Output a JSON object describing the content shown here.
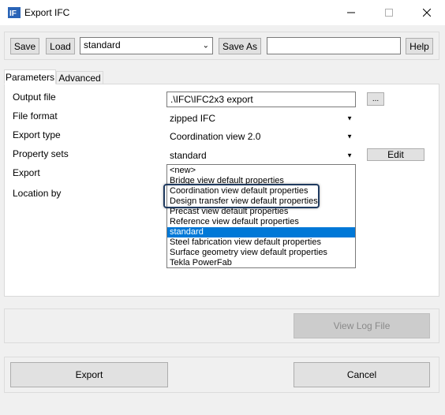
{
  "window": {
    "title": "Export IFC"
  },
  "toolbar": {
    "save_label": "Save",
    "load_label": "Load",
    "preset_value": "standard",
    "save_as_label": "Save As",
    "save_as_value": "",
    "help_label": "Help"
  },
  "tabs": [
    {
      "label": "Parameters"
    },
    {
      "label": "Advanced"
    }
  ],
  "parameters": {
    "output_file": {
      "label": "Output file",
      "value": ".\\IFC\\IFC2x3 export",
      "browse_label": "..."
    },
    "file_format": {
      "label": "File format",
      "value": "zipped IFC"
    },
    "export_type": {
      "label": "Export type",
      "value": "Coordination view 2.0"
    },
    "property_sets": {
      "label": "Property sets",
      "value": "standard",
      "edit_label": "Edit"
    },
    "export": {
      "label": "Export"
    },
    "location_by": {
      "label": "Location by"
    }
  },
  "property_sets_options": [
    "<new>",
    "Bridge view default properties",
    "Coordination view default properties",
    "Design transfer view default properties",
    "Precast view default properties",
    "Reference view default properties",
    "standard",
    "Steel fabrication view default properties",
    "Surface geometry view default properties",
    "Tekla PowerFab"
  ],
  "selected_option": "standard",
  "highlighted_options": [
    "Coordination view default properties",
    "Design transfer view default properties"
  ],
  "log": {
    "view_log_label": "View Log File"
  },
  "footer": {
    "export_label": "Export",
    "cancel_label": "Cancel"
  },
  "colors": {
    "selection": "#0078d7",
    "highlight_border": "#1f3a5f"
  }
}
